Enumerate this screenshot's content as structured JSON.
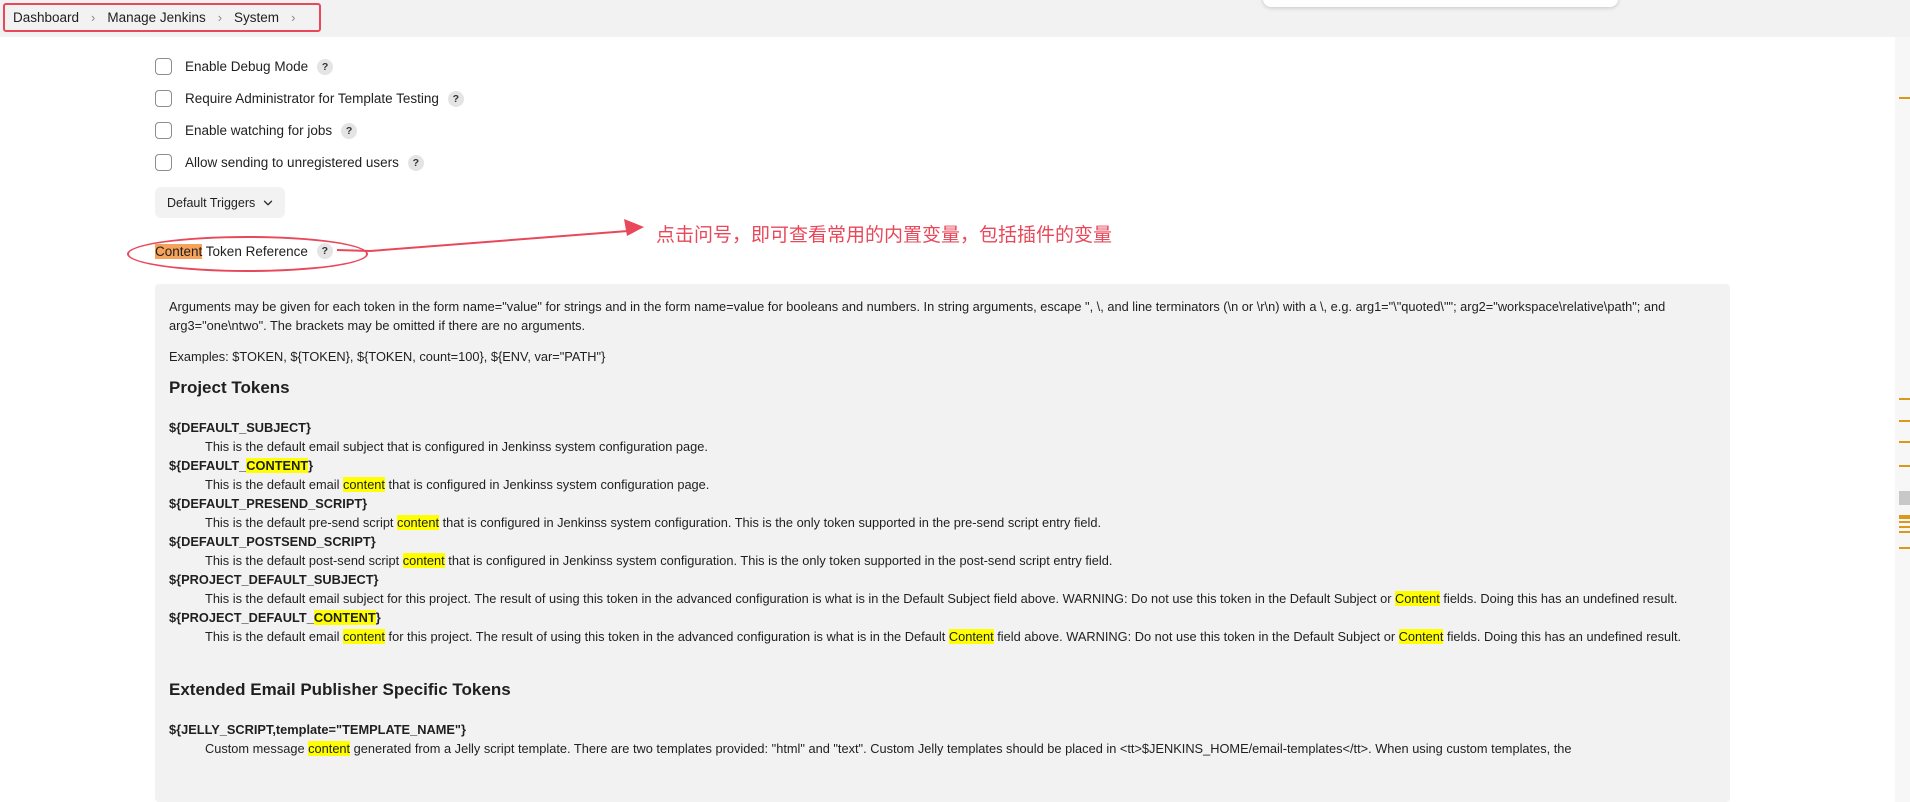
{
  "breadcrumb": {
    "items": [
      "Dashboard",
      "Manage Jenkins",
      "System"
    ]
  },
  "options": [
    {
      "label": "Enable Debug Mode"
    },
    {
      "label": "Require Administrator for Template Testing"
    },
    {
      "label": "Enable watching for jobs"
    },
    {
      "label": "Allow sending to unregistered users"
    }
  ],
  "help_glyph": "?",
  "default_triggers": {
    "label": "Default Triggers"
  },
  "token_reference": {
    "label_highlight": "Content",
    "label_rest": " Token Reference"
  },
  "annotation": {
    "text": "点击问号，即可查看常用的内置变量，包括插件的变量"
  },
  "help_panel": {
    "intro": "Arguments may be given for each token in the form name=\"value\" for strings and in the form name=value for booleans and numbers. In string arguments, escape \", \\, and line terminators (\\n or \\r\\n) with a \\, e.g. arg1=\"\\\"quoted\\\"\"; arg2=\"workspace\\relative\\path\"; and arg3=\"one\\ntwo\". The brackets may be omitted if there are no arguments.",
    "examples": "Examples: $TOKEN, ${TOKEN}, ${TOKEN, count=100}, ${ENV, var=\"PATH\"}",
    "project_heading": "Project Tokens",
    "tokens": [
      {
        "name": [
          {
            "t": "${DEFAULT_SUBJECT}"
          }
        ],
        "desc": [
          {
            "t": "This is the default email subject that is configured in Jenkinss system configuration page."
          }
        ]
      },
      {
        "name": [
          {
            "t": "${DEFAULT_"
          },
          {
            "t": "CONTENT",
            "hl": true
          },
          {
            "t": "}"
          }
        ],
        "desc": [
          {
            "t": "This is the default email "
          },
          {
            "t": "content",
            "hl": true
          },
          {
            "t": " that is configured in Jenkinss system configuration page."
          }
        ]
      },
      {
        "name": [
          {
            "t": "${DEFAULT_PRESEND_SCRIPT}"
          }
        ],
        "desc": [
          {
            "t": "This is the default pre-send script "
          },
          {
            "t": "content",
            "hl": true
          },
          {
            "t": " that is configured in Jenkinss system configuration. This is the only token supported in the pre-send script entry field."
          }
        ]
      },
      {
        "name": [
          {
            "t": "${DEFAULT_POSTSEND_SCRIPT}"
          }
        ],
        "desc": [
          {
            "t": "This is the default post-send script "
          },
          {
            "t": "content",
            "hl": true
          },
          {
            "t": " that is configured in Jenkinss system configuration. This is the only token supported in the post-send script entry field."
          }
        ]
      },
      {
        "name": [
          {
            "t": "${PROJECT_DEFAULT_SUBJECT}"
          }
        ],
        "desc": [
          {
            "t": "This is the default email subject for this project. The result of using this token in the advanced configuration is what is in the Default Subject field above. WARNING: Do not use this token in the Default Subject or "
          },
          {
            "t": "Content",
            "hl": true
          },
          {
            "t": " fields. Doing this has an undefined result."
          }
        ]
      },
      {
        "name": [
          {
            "t": "${PROJECT_DEFAULT_"
          },
          {
            "t": "CONTENT",
            "hl": true
          },
          {
            "t": "}"
          }
        ],
        "desc": [
          {
            "t": "This is the default email "
          },
          {
            "t": "content",
            "hl": true
          },
          {
            "t": " for this project. The result of using this token in the advanced configuration is what is in the Default "
          },
          {
            "t": "Content",
            "hl": true
          },
          {
            "t": " field above. WARNING: Do not use this token in the Default Subject or "
          },
          {
            "t": "Content",
            "hl": true
          },
          {
            "t": " fields. Doing this has an undefined result."
          }
        ]
      }
    ],
    "extended_heading": "Extended Email Publisher Specific Tokens",
    "extended_tokens": [
      {
        "name": [
          {
            "t": "${JELLY_SCRIPT,template=\"TEMPLATE_NAME\"}"
          }
        ],
        "desc": [
          {
            "t": "Custom message "
          },
          {
            "t": "content",
            "hl": true
          },
          {
            "t": " generated from a Jelly script template. There are two templates provided: \"html\" and \"text\". Custom Jelly templates should be placed in <tt>$JENKINS_HOME/email-templates</tt>. When using custom templates, the"
          }
        ]
      }
    ]
  },
  "colors": {
    "annotation_red": "#e8485a",
    "highlight_yellow": "#ffff00",
    "highlight_orange": "#f5a25b",
    "panel_bg": "#f2f2f2",
    "scroll_marker": "#d99a1c"
  },
  "icons": [
    "chevron-right-icon",
    "help-icon",
    "chevron-down-icon",
    "checkbox-icon",
    "arrow-annotation"
  ]
}
